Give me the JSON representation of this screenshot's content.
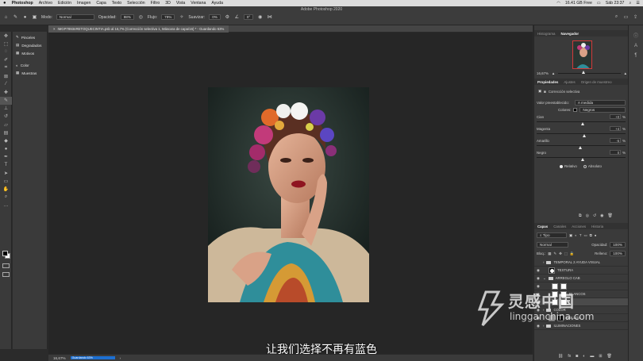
{
  "menubar": {
    "apple": "",
    "items": [
      "Photoshop",
      "Archivo",
      "Edición",
      "Imagen",
      "Capa",
      "Texto",
      "Selección",
      "Filtro",
      "3D",
      "Vista",
      "Ventana",
      "Ayuda"
    ],
    "status": {
      "storage": "16.41 GB Free",
      "date_time": "Sáb 23:37"
    }
  },
  "app_title": "Adobe Photoshop 2020",
  "options": {
    "mode_label": "Modo:",
    "mode_value": "Normal",
    "opacity_label": "Opacidad:",
    "opacity_value": "98%",
    "flow_label": "Flujo:",
    "flow_value": "79%",
    "smoothing_label": "Suavizar:",
    "smoothing_value": "0%",
    "angle_value": "0°"
  },
  "left_panel": {
    "groups": [
      [
        {
          "icon": "brush-icon",
          "label": "Pinceles"
        },
        {
          "icon": "gradient-icon",
          "label": "Degradados"
        },
        {
          "icon": "pattern-icon",
          "label": "Motivos"
        }
      ],
      [
        {
          "icon": "color-icon",
          "label": "Color"
        },
        {
          "icon": "swatches-icon",
          "label": "Muestras"
        }
      ]
    ]
  },
  "document": {
    "tab_label": "IMGP7893nRETOQUECINTIA.psb al 16,7% (Corrección selectiva 1, Máscara de capa/16) * - Guardando 63%"
  },
  "subtitle": "让我们选择不再有蓝色",
  "status": {
    "zoom": "16,67%",
    "saving": "Guardando 63%"
  },
  "navigator": {
    "tabs": [
      "Histograma",
      "Navegador"
    ],
    "active": 1,
    "zoom": "16,67%"
  },
  "properties": {
    "tabs": [
      "Propiedades",
      "Ajustes",
      "Origen de muestreo"
    ],
    "active": 0,
    "header": "Corrección selectiva",
    "preset_label": "Valor preestablecido:",
    "preset_value": "A medida",
    "colors_label": "Colores:",
    "colors_value": "Negros",
    "sliders": [
      {
        "label": "Cian",
        "value": "+0",
        "pct": 0.5
      },
      {
        "label": "Magenta",
        "value": "+4",
        "pct": 0.52
      },
      {
        "label": "Amarillo",
        "value": "-5",
        "pct": 0.47
      },
      {
        "label": "Negro",
        "value": "0",
        "pct": 0.5
      }
    ],
    "unit": "%",
    "method": [
      {
        "label": "Relativo",
        "checked": true
      },
      {
        "label": "Absoluto",
        "checked": false
      }
    ]
  },
  "layers": {
    "tabs": [
      "Capas",
      "Canales",
      "Acciones",
      "Historia"
    ],
    "active": 0,
    "filter_kind": "Tipo",
    "blend_mode": "Normal",
    "opacity_label": "Opacidad:",
    "opacity_value": "100%",
    "lock_label": "Bloq.:",
    "fill_label": "Relleno:",
    "fill_value": "100%",
    "items": [
      {
        "name": "TEMPORAL 2 AYUDA VISUAL",
        "kind": "folder",
        "visible": false
      },
      {
        "name": "TEXTURA",
        "kind": "layer",
        "visible": true
      },
      {
        "name": "ARREGLO CAB",
        "kind": "folder",
        "visible": true
      },
      {
        "name": "",
        "kind": "adjust",
        "visible": true
      },
      {
        "name": "BLANCOS",
        "kind": "adjust",
        "visible": true
      },
      {
        "name": "",
        "kind": "adjust",
        "visible": true
      },
      {
        "name": "COLOR",
        "kind": "folder",
        "visible": true
      },
      {
        "name": "BRILLOS",
        "kind": "layer",
        "visible": true
      },
      {
        "name": "ILUMINACIONES",
        "kind": "folder",
        "visible": true
      }
    ]
  },
  "watermark": {
    "brand": "灵感中国",
    "url": "lingganchina.com"
  },
  "colors": {
    "accent": "#1d6fd1",
    "background": "#262626",
    "panel": "#3a3a3a"
  }
}
